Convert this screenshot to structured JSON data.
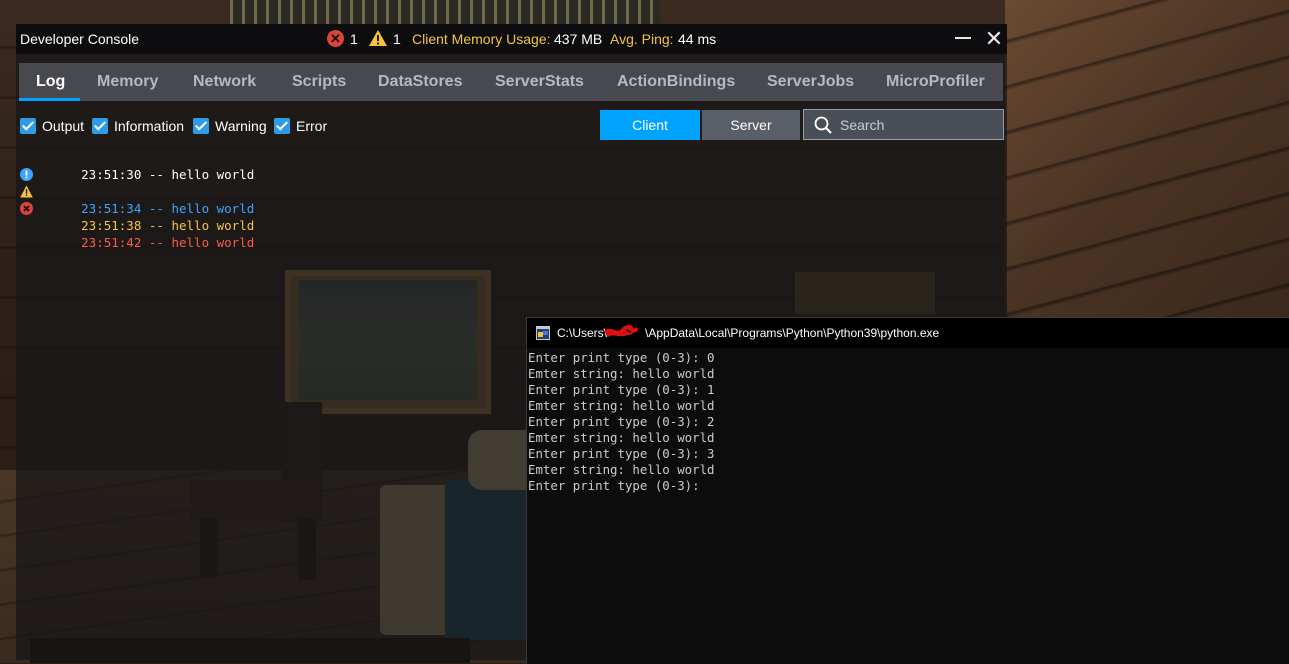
{
  "dev_console": {
    "title": "Developer Console",
    "error_count": "1",
    "warning_count": "1",
    "memory_label": "Client Memory Usage:",
    "memory_value": "437 MB",
    "ping_label": "Avg. Ping:",
    "ping_value": "44 ms",
    "tabs": [
      {
        "label": "Log",
        "active": true
      },
      {
        "label": "Memory",
        "active": false
      },
      {
        "label": "Network",
        "active": false
      },
      {
        "label": "Scripts",
        "active": false
      },
      {
        "label": "DataStores",
        "active": false
      },
      {
        "label": "ServerStats",
        "active": false
      },
      {
        "label": "ActionBindings",
        "active": false
      },
      {
        "label": "ServerJobs",
        "active": false
      },
      {
        "label": "MicroProfiler",
        "active": false
      }
    ],
    "filters": [
      {
        "label": "Output",
        "checked": true
      },
      {
        "label": "Information",
        "checked": true
      },
      {
        "label": "Warning",
        "checked": true
      },
      {
        "label": "Error",
        "checked": true
      }
    ],
    "client_button": "Client",
    "server_button": "Server",
    "search_placeholder": "Search",
    "log": [
      {
        "text": "23:51:30 -- hello world",
        "level": "output"
      },
      {
        "text": "23:51:34 -- hello world",
        "level": "info"
      },
      {
        "text": "23:51:38 -- hello world",
        "level": "warning"
      },
      {
        "text": "23:51:42 -- hello world",
        "level": "error"
      }
    ],
    "colors": {
      "accent": "#00a2ff",
      "info": "#3da4ff",
      "warning": "#f5c542",
      "error": "#ff5a4a"
    }
  },
  "python_window": {
    "title_prefix": "C:\\Users\\",
    "title_suffix": "\\AppData\\Local\\Programs\\Python\\Python39\\python.exe",
    "lines": [
      "Enter print type (0-3): 0",
      "Emter string: hello world",
      "Enter print type (0-3): 1",
      "Emter string: hello world",
      "Enter print type (0-3): 2",
      "Emter string: hello world",
      "Enter print type (0-3): 3",
      "Emter string: hello world",
      "Enter print type (0-3): "
    ]
  }
}
